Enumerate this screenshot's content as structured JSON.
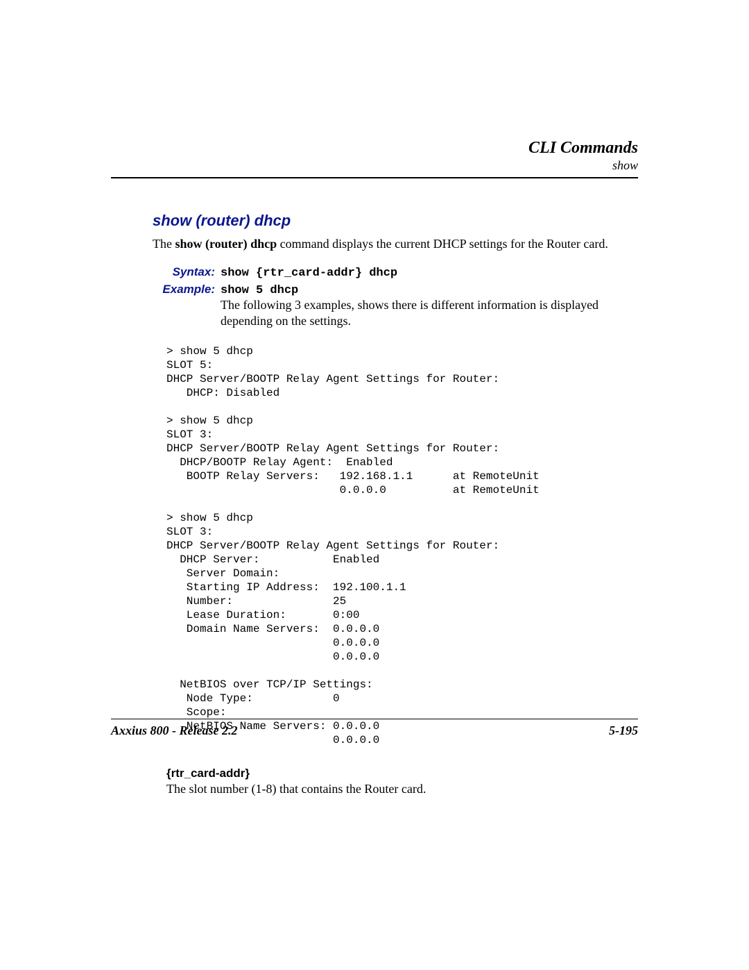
{
  "header": {
    "chapter_title": "CLI Commands",
    "section_name": "show"
  },
  "body": {
    "heading": "show (router) dhcp",
    "intro_prefix": "The ",
    "intro_bold": "show (router) dhcp",
    "intro_suffix": " command displays the current DHCP settings for the Router card.",
    "syntax": {
      "label": "Syntax:",
      "value": "show {rtr_card-addr} dhcp"
    },
    "example": {
      "label": "Example:",
      "value": "show 5 dhcp",
      "description": "The following 3 examples, shows there is different information is displayed depending on the settings."
    },
    "cli_output": "> show 5 dhcp\nSLOT 5:\nDHCP Server/BOOTP Relay Agent Settings for Router:\n   DHCP: Disabled\n\n> show 5 dhcp\nSLOT 3:\nDHCP Server/BOOTP Relay Agent Settings for Router:\n  DHCP/BOOTP Relay Agent:  Enabled\n   BOOTP Relay Servers:   192.168.1.1      at RemoteUnit\n                          0.0.0.0          at RemoteUnit\n\n> show 5 dhcp\nSLOT 3:\nDHCP Server/BOOTP Relay Agent Settings for Router:\n  DHCP Server:           Enabled\n   Server Domain:\n   Starting IP Address:  192.100.1.1\n   Number:               25\n   Lease Duration:       0:00\n   Domain Name Servers:  0.0.0.0\n                         0.0.0.0\n                         0.0.0.0\n\n  NetBIOS over TCP/IP Settings:\n   Node Type:            0\n   Scope:\n   NetBIOS Name Servers: 0.0.0.0\n                         0.0.0.0",
    "param": {
      "name": "{rtr_card-addr}",
      "desc": "The slot number (1-8) that contains the Router card."
    }
  },
  "footer": {
    "left": "Axxius 800 - Release 2.2",
    "right": "5-195"
  }
}
